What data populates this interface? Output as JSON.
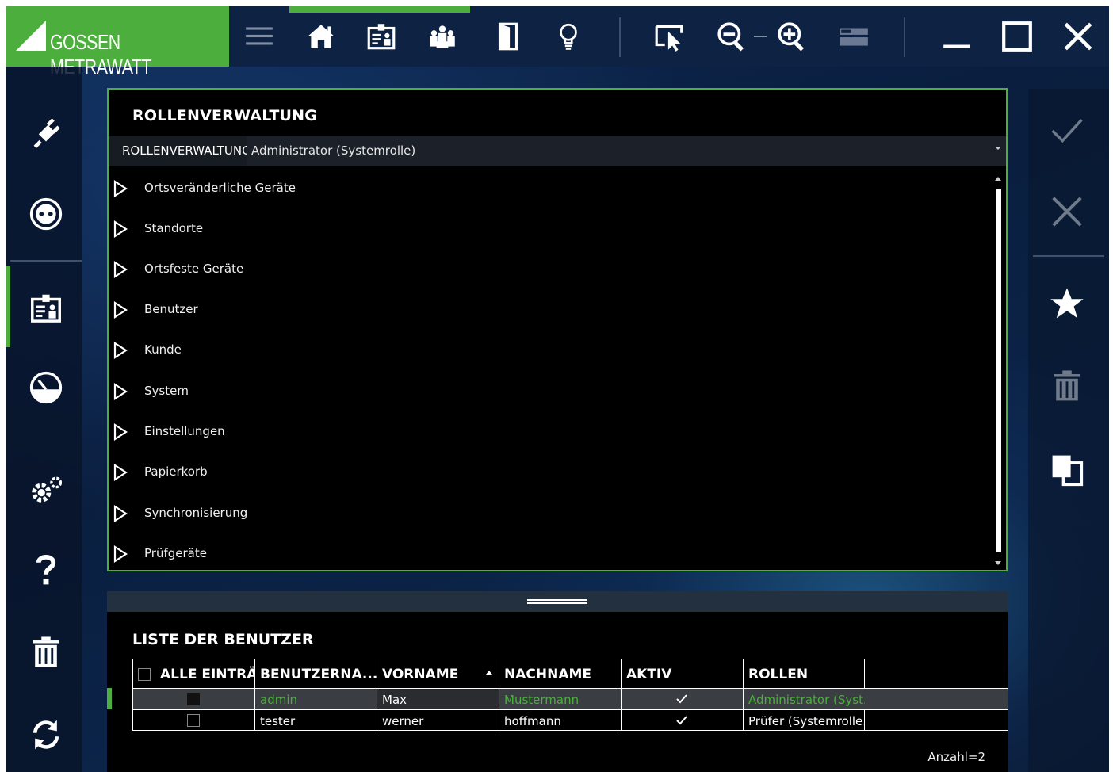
{
  "app": {
    "brand": "GOSSEN METRAWATT",
    "colors": {
      "accent": "#4caf3d",
      "panel": "#000000",
      "topbar": "#0e2244"
    }
  },
  "topbar": {
    "icons": [
      "menu-icon",
      "home-icon",
      "id-badge-icon",
      "group-icon",
      "door-icon",
      "lightbulb-icon",
      "select-cursor-icon",
      "zoom-out-icon",
      "zoom-in-icon",
      "panel-layout-icon",
      "minimize-icon",
      "maximize-icon",
      "close-icon"
    ],
    "active": "id-badge-icon"
  },
  "leftbar": {
    "icons": [
      "plug-icon",
      "socket-icon",
      "id-badge-icon",
      "gauge-icon",
      "settings-gears-icon",
      "help-icon",
      "trash-icon",
      "sync-icon"
    ],
    "active": "id-badge-icon"
  },
  "rightbar": {
    "icons": [
      "confirm-check-icon",
      "cancel-x-icon",
      "favorite-star-icon",
      "delete-trash-icon",
      "copy-icon"
    ]
  },
  "role_panel": {
    "title": "ROLLENVERWALTUNG",
    "select_label": "ROLLENVERWALTUNG",
    "selected_role": "Administrator (Systemrolle)",
    "tree_items": [
      "Ortsveränderliche Geräte",
      "Standorte",
      "Ortsfeste Geräte",
      "Benutzer",
      "Kunde",
      "System",
      "Einstellungen",
      "Papierkorb",
      "Synchronisierung",
      "Prüfgeräte"
    ]
  },
  "users_panel": {
    "title": "LISTE DER BENUTZER",
    "columns": [
      "ALLE EINTRÄ(",
      "BENUTZERNA...",
      "VORNAME",
      "NACHNAME",
      "AKTIV",
      "ROLLEN"
    ],
    "sorted_column": "VORNAME",
    "rows": [
      {
        "checked": true,
        "username": "admin",
        "vorname": "Max",
        "nachname": "Mustermann",
        "aktiv": true,
        "rollen": "Administrator (Syst..."
      },
      {
        "checked": false,
        "username": "tester",
        "vorname": "werner",
        "nachname": "hoffmann",
        "aktiv": true,
        "rollen": "Prüfer (Systemrolle..."
      }
    ],
    "count_label": "Anzahl=2"
  }
}
